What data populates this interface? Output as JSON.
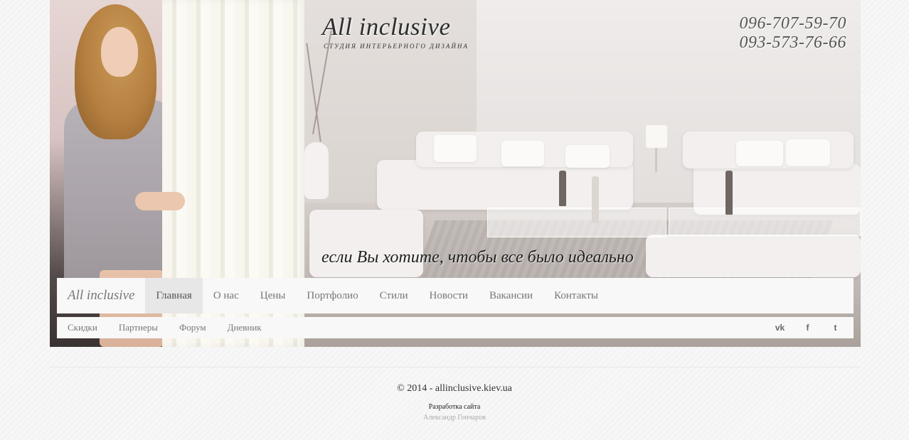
{
  "header": {
    "brand_title": "All inclusive",
    "brand_subtitle": "СТУДИЯ ИНТЕРЬЕРНОГО ДИЗАЙНА",
    "phones": [
      "096-707-59-70",
      "093-573-76-66"
    ],
    "tagline": "если Вы хотите, чтобы все было идеально"
  },
  "nav": {
    "brand": "All inclusive",
    "items": [
      {
        "label": "Главная",
        "active": true
      },
      {
        "label": "О нас"
      },
      {
        "label": "Цены"
      },
      {
        "label": "Портфолио"
      },
      {
        "label": "Стили"
      },
      {
        "label": "Новости"
      },
      {
        "label": "Вакансии"
      },
      {
        "label": "Контакты"
      }
    ]
  },
  "subnav": {
    "items": [
      "Скидки",
      "Партнеры",
      "Форум",
      "Дневник"
    ],
    "social": [
      {
        "icon": "vk-icon",
        "glyph": "vk"
      },
      {
        "icon": "facebook-icon",
        "glyph": "f"
      },
      {
        "icon": "twitter-icon",
        "glyph": "t"
      }
    ]
  },
  "footer": {
    "copyright": "© 2014 - allinclusive.kiev.ua",
    "dev_label": "Разработка сайта",
    "dev_name": "Александр Гончаров"
  }
}
